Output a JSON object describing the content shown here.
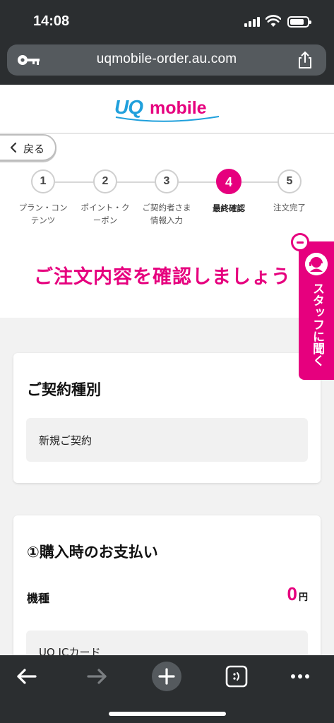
{
  "status_bar": {
    "time": "14:08"
  },
  "browser": {
    "url": "uqmobile-order.au.com"
  },
  "header": {
    "logo_uq": "UQ",
    "logo_mobile": "mobile"
  },
  "back_button": {
    "label": "戻る"
  },
  "steps": [
    {
      "number": "1",
      "label": "プラン・コン\nテンツ",
      "active": false
    },
    {
      "number": "2",
      "label": "ポイント・ク\nーポン",
      "active": false
    },
    {
      "number": "3",
      "label": "ご契約者さま\n情報入力",
      "active": false
    },
    {
      "number": "4",
      "label": "最終確認",
      "active": true
    },
    {
      "number": "5",
      "label": "注文完了",
      "active": false
    }
  ],
  "page_title": "ご注文内容を確認しましょう",
  "staff_tab": {
    "label": "スタッフに聞く"
  },
  "contract_card": {
    "heading": "ご契約種別",
    "value": "新規ご契約"
  },
  "payment_card": {
    "heading": "①購入時のお支払い",
    "device_label": "機種",
    "device_price": "0",
    "price_unit": "円",
    "item": "UQ ICカード"
  },
  "colors": {
    "accent": "#e6007e",
    "brand_blue": "#20a0dc",
    "chrome": "#2b2e30"
  }
}
